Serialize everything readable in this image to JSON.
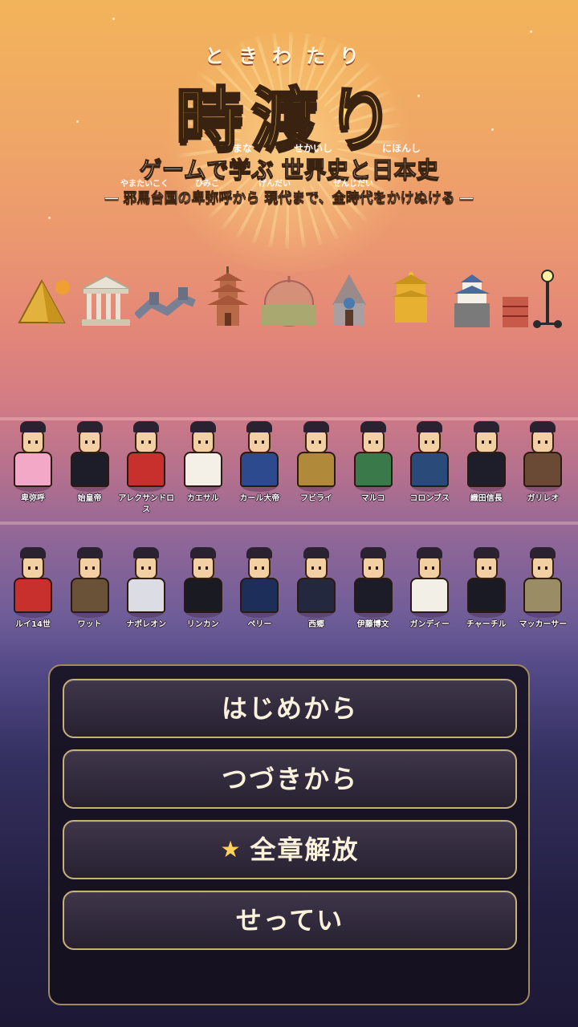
{
  "title": {
    "ruby": "ときわたり",
    "main": "時渡り",
    "subtitle": "ゲームで学ぶ 世界史と日本史",
    "subtitle_ruby": [
      "まな",
      "せかいし",
      "にほんし"
    ],
    "tagline": "― 邪馬台国の卑弥呼から 現代まで、全時代をかけぬける ―",
    "tagline_ruby": [
      "やまたいこく",
      "ひみこ",
      "げんだい",
      "ぜんじだい"
    ]
  },
  "eras": [
    "pyramid-icon",
    "temple-icon",
    "great-wall-icon",
    "pagoda-icon",
    "colosseum-icon",
    "castle-tower-icon",
    "golden-pavilion-icon",
    "japanese-castle-icon",
    "brick-factory-icon",
    "street-lamp-icon"
  ],
  "characters_row1": [
    {
      "name": "卑弥呼",
      "color": "#f4a8c8"
    },
    {
      "name": "始皇帝",
      "color": "#1d1d2a"
    },
    {
      "name": "アレクサンドロス",
      "color": "#c8302e"
    },
    {
      "name": "カエサル",
      "color": "#f4f0e8"
    },
    {
      "name": "カール大帝",
      "color": "#2e4a8e"
    },
    {
      "name": "フビライ",
      "color": "#b08a3a"
    },
    {
      "name": "マルコ",
      "color": "#3a7a4a"
    },
    {
      "name": "コロンブス",
      "color": "#2a4a7a"
    },
    {
      "name": "織田信長",
      "color": "#1e1e2a"
    },
    {
      "name": "ガリレオ",
      "color": "#6a4a34"
    }
  ],
  "characters_row2": [
    {
      "name": "ルイ14世",
      "color": "#c8302e"
    },
    {
      "name": "ワット",
      "color": "#6a5238"
    },
    {
      "name": "ナポレオン",
      "color": "#dcdce4"
    },
    {
      "name": "リンカン",
      "color": "#1a1a22"
    },
    {
      "name": "ペリー",
      "color": "#1e2e5a"
    },
    {
      "name": "西郷",
      "color": "#23283e"
    },
    {
      "name": "伊藤博文",
      "color": "#1c1c28"
    },
    {
      "name": "ガンディー",
      "color": "#f2efe6"
    },
    {
      "name": "チャーチル",
      "color": "#1a1a24"
    },
    {
      "name": "マッカーサー",
      "color": "#9a8c64"
    }
  ],
  "menu": {
    "start": "はじめから",
    "continue": "つづきから",
    "unlock_all": "全章解放",
    "unlock_icon": "star-icon",
    "settings": "せってい"
  },
  "colors": {
    "title_gold": "#ffd866",
    "button_border": "#c8b078",
    "star": "#ffd25a"
  }
}
